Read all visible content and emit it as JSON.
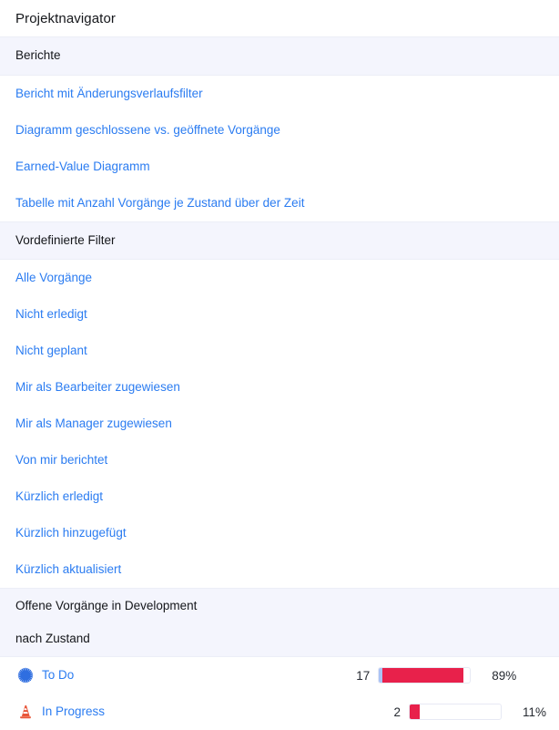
{
  "header": {
    "title": "Projektnavigator"
  },
  "sections": [
    {
      "name": "reports",
      "head": [
        "Berichte"
      ],
      "links": [
        {
          "name": "report-change-history-filter",
          "label": "Bericht mit Änderungsverlaufsfilter"
        },
        {
          "name": "chart-closed-vs-opened-issues",
          "label": "Diagramm geschlossene vs. geöffnete Vorgänge"
        },
        {
          "name": "earned-value-chart",
          "label": "Earned-Value Diagramm"
        },
        {
          "name": "table-issue-count-by-state-over-time",
          "label": "Tabelle mit Anzahl Vorgänge je Zustand über der Zeit"
        }
      ]
    },
    {
      "name": "predefined-filters",
      "head": [
        "Vordefinierte Filter"
      ],
      "links": [
        {
          "name": "all-issues",
          "label": "Alle Vorgänge"
        },
        {
          "name": "not-done",
          "label": "Nicht erledigt"
        },
        {
          "name": "not-planned",
          "label": "Nicht geplant"
        },
        {
          "name": "assigned-to-me-as-assignee",
          "label": "Mir als Bearbeiter zugewiesen"
        },
        {
          "name": "assigned-to-me-as-manager",
          "label": "Mir als Manager zugewiesen"
        },
        {
          "name": "reported-by-me",
          "label": "Von mir berichtet"
        },
        {
          "name": "recently-done",
          "label": "Kürzlich erledigt"
        },
        {
          "name": "recently-added",
          "label": "Kürzlich hinzugefügt"
        },
        {
          "name": "recently-updated",
          "label": "Kürzlich aktualisiert"
        }
      ]
    }
  ],
  "open_issues": {
    "head": [
      "Offene Vorgänge in Development",
      "nach Zustand"
    ],
    "rows": [
      {
        "name": "to-do",
        "icon": "blue-starburst-icon",
        "label": "To Do",
        "count": "17",
        "percent_label": "89%",
        "percent": 89,
        "lead_percent": 4
      },
      {
        "name": "in-progress",
        "icon": "traffic-cone-icon",
        "label": "In Progress",
        "count": "2",
        "percent_label": "11%",
        "percent": 11,
        "lead_percent": 0
      }
    ]
  },
  "colors": {
    "link": "#2b7cf1",
    "band": "#f4f5fd",
    "bar_fill": "#e8214b",
    "bar_lead": "#aac3f5",
    "text": "#14161a"
  }
}
